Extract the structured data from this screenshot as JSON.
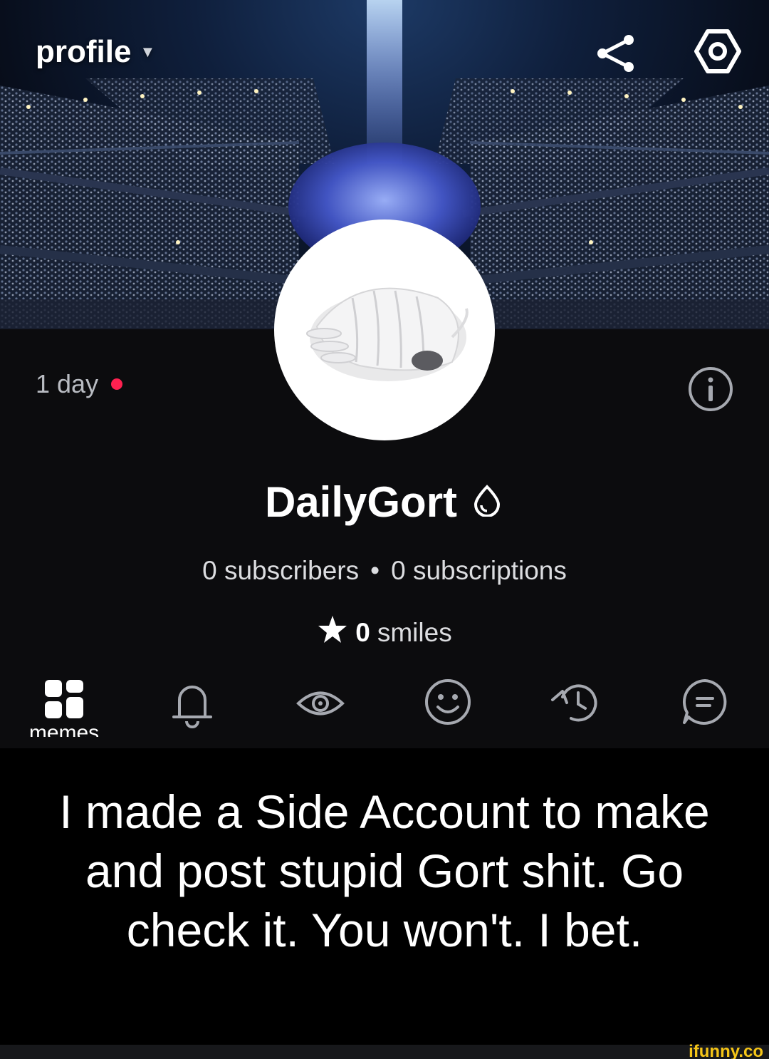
{
  "header": {
    "title": "profile",
    "share_icon": "share-icon",
    "settings_icon": "settings-icon"
  },
  "profile": {
    "age": "1 day",
    "username": "DailyGort",
    "subscribers": "0 subscribers",
    "separator": "•",
    "subscriptions": "0 subscriptions",
    "smiles_count": "0",
    "smiles_label": "smiles",
    "info_icon": "info-icon"
  },
  "tabs": [
    {
      "icon": "grid-icon",
      "label": "memes"
    },
    {
      "icon": "bell-icon"
    },
    {
      "icon": "eye-icon"
    },
    {
      "icon": "smiley-icon"
    },
    {
      "icon": "history-icon"
    },
    {
      "icon": "comment-icon"
    }
  ],
  "caption": "I made a Side Account to make and post stupid Gort shit. Go check it. You won't. I bet.",
  "watermark": "ifunny.co",
  "colors": {
    "online_dot": "#ff2150",
    "background": "#0c0c0e",
    "watermark": "#f5c518"
  }
}
